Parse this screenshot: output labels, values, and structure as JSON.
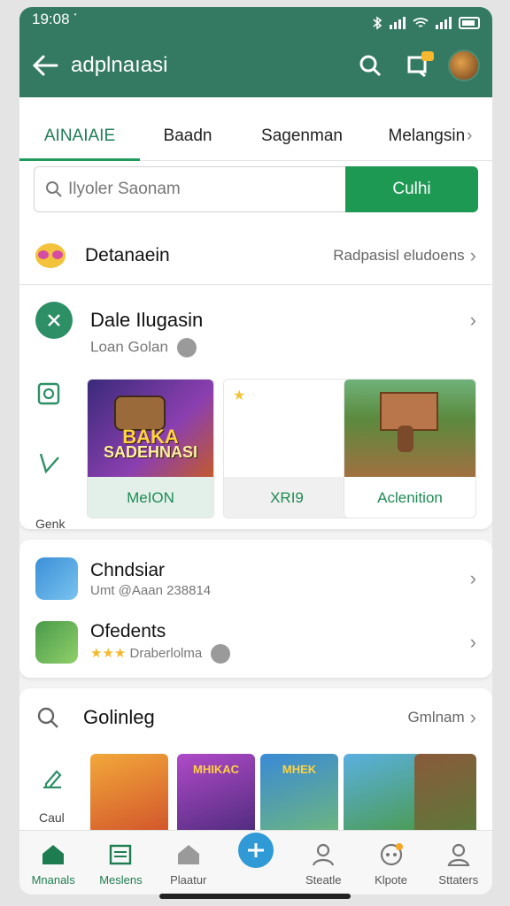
{
  "status": {
    "time": "19:08",
    "extra": "་"
  },
  "appbar": {
    "title": "adplnaıasi"
  },
  "tabs": [
    "AINAIAIE",
    "Baadn",
    "Sagenman",
    "Melangsin"
  ],
  "search": {
    "placeholder": "Ilyoler Saonam",
    "button": "Culhi"
  },
  "section1": {
    "title": "Detanaein",
    "link": "Radpasisl eludoens"
  },
  "section2": {
    "title": "Dale Ilugasin",
    "subtitle": "Loan Golan"
  },
  "side_label": "Genk",
  "games": [
    {
      "art_title": "BAKA",
      "art_sub": "SADEHNASI",
      "button": "MeION",
      "badge": ""
    },
    {
      "art_title": "",
      "art_sub": "",
      "button": "XRI9",
      "badge": ""
    },
    {
      "art_title": "",
      "art_sub": "",
      "button": "Aclenition",
      "badge": ""
    }
  ],
  "mid_items": [
    {
      "title": "Chndsiar",
      "subtitle": "Umt @Aaan 238814"
    },
    {
      "title": "Ofedents",
      "subtitle": "Draberlolma"
    }
  ],
  "bottom_section": {
    "title": "Golinleg",
    "link": "Gmlnam",
    "side_label": "Caul"
  },
  "thumbs": [
    {
      "title": ""
    },
    {
      "title": "MHIKAC"
    },
    {
      "title": "MHEK"
    },
    {
      "title": ""
    },
    {
      "title": ""
    }
  ],
  "nav": [
    {
      "label": "Mnanals",
      "icon": "home-icon"
    },
    {
      "label": "Meslens",
      "icon": "calendar-icon"
    },
    {
      "label": "Plaatur",
      "icon": "house-icon"
    },
    {
      "label": "",
      "icon": "plane-icon"
    },
    {
      "label": "Steatle",
      "icon": "person-icon"
    },
    {
      "label": "Klpote",
      "icon": "gamepad-icon"
    },
    {
      "label": "Sttaters",
      "icon": "profile-icon"
    }
  ],
  "colors": {
    "brand": "#347a63",
    "accent": "#1e9953"
  }
}
